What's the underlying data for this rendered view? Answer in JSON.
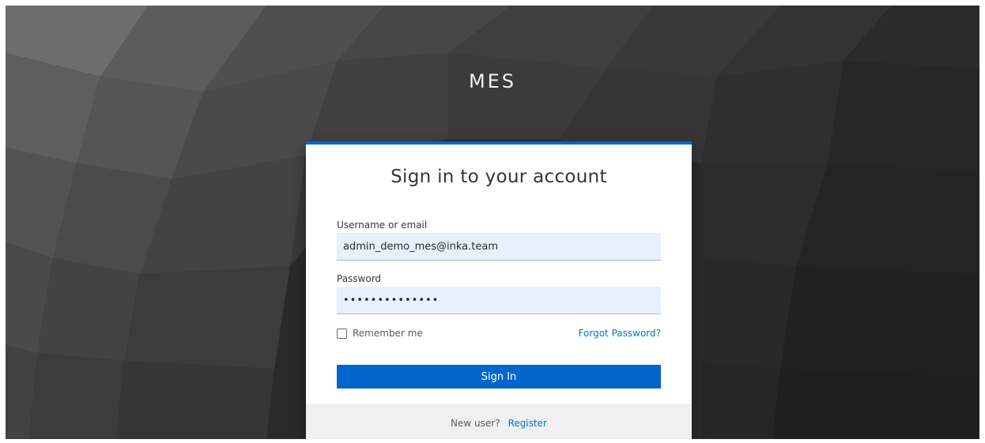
{
  "realm": {
    "title": "MES"
  },
  "login": {
    "heading": "Sign in to your account",
    "username_label": "Username or email",
    "username_value": "admin_demo_mes@inka.team",
    "password_label": "Password",
    "password_value": "••••••••••••••",
    "remember_label": "Remember me",
    "remember_checked": false,
    "forgot_label": "Forgot Password?",
    "signin_label": "Sign In"
  },
  "footer": {
    "new_user_text": "New user?",
    "register_label": "Register"
  },
  "colors": {
    "accent": "#0066cc",
    "link": "#0077c8",
    "input_bg": "#e8f0fe",
    "footer_bg": "#f0f0f0"
  }
}
